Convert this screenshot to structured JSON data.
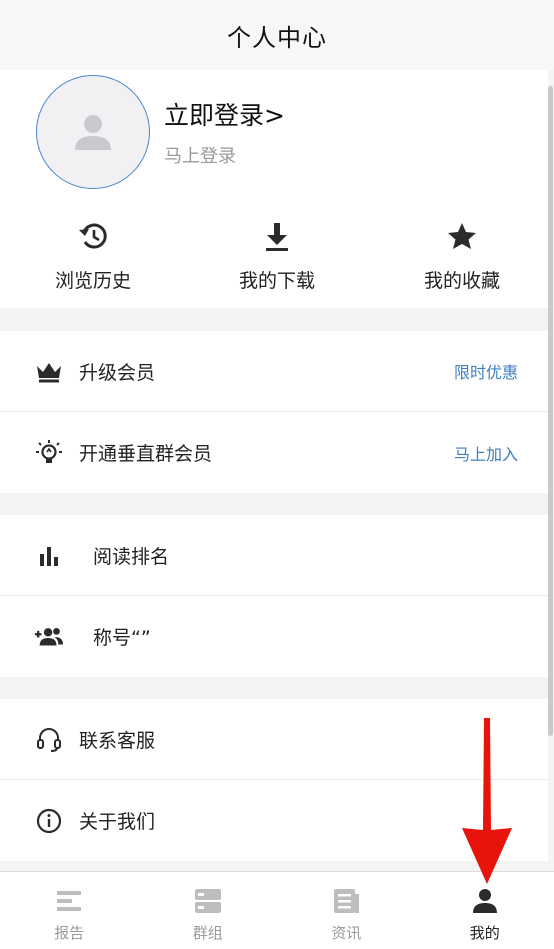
{
  "header": {
    "title": "个人中心"
  },
  "profile": {
    "login_title": "立即登录>",
    "login_subtitle": "马上登录"
  },
  "quick_actions": [
    {
      "label": "浏览历史",
      "icon": "history-icon"
    },
    {
      "label": "我的下载",
      "icon": "download-icon"
    },
    {
      "label": "我的收藏",
      "icon": "star-icon"
    }
  ],
  "menu": {
    "upgrade": {
      "label": "升级会员",
      "extra": "限时优惠",
      "icon": "crown-icon"
    },
    "vertical_group": {
      "label": "开通垂直群会员",
      "extra": "马上加入",
      "icon": "lightbulb-icon"
    },
    "ranking": {
      "label": "阅读排名",
      "icon": "bar-chart-icon"
    },
    "nickname": {
      "label": "称号“”",
      "icon": "add-group-icon"
    },
    "support": {
      "label": "联系客服",
      "icon": "headset-icon"
    },
    "about": {
      "label": "关于我们",
      "icon": "info-icon"
    }
  },
  "tabbar": [
    {
      "label": "报告",
      "icon": "report-icon",
      "active": false
    },
    {
      "label": "群组",
      "icon": "group-icon",
      "active": false
    },
    {
      "label": "资讯",
      "icon": "news-icon",
      "active": false
    },
    {
      "label": "我的",
      "icon": "person-icon",
      "active": true
    }
  ],
  "colors": {
    "accent": "#3f7fc2",
    "arrow": "#e8140c",
    "inactive": "#9b9b9b"
  }
}
